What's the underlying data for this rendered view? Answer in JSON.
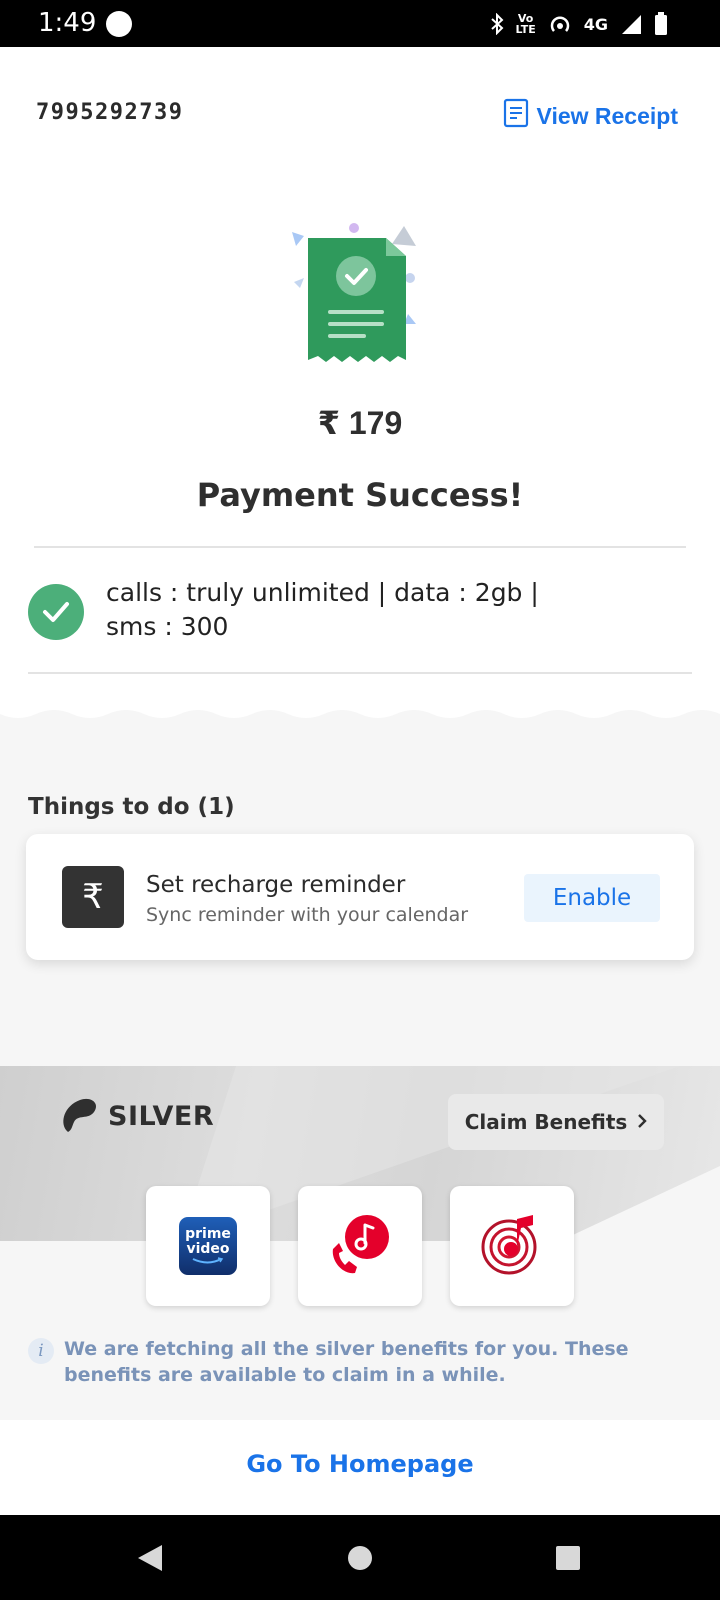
{
  "status_bar": {
    "time": "1:49",
    "volte_top": "Vo",
    "volte_bottom": "LTE",
    "network": "4G"
  },
  "header": {
    "phone_number": "7995292739",
    "view_receipt_label": "View Receipt"
  },
  "payment": {
    "amount": "₹ 179",
    "status_title": "Payment Success!",
    "plan_details": "calls : truly unlimited | data : 2gb | sms : 300"
  },
  "things_to_do": {
    "title": "Things to do (1)",
    "items": [
      {
        "icon_glyph": "₹",
        "title": "Set recharge reminder",
        "subtitle": "Sync reminder with your calendar",
        "action_label": "Enable"
      }
    ]
  },
  "silver": {
    "tier_label": "SILVER",
    "claim_label": "Claim Benefits",
    "benefits": [
      {
        "name": "prime-video",
        "line1": "prime",
        "line2": "video"
      },
      {
        "name": "hellotunes",
        "icon": "music-phone-icon"
      },
      {
        "name": "wynk-music",
        "icon": "wynk-music-icon"
      }
    ],
    "info_text": "We are fetching all the silver benefits for you. These benefits are available to claim in a while."
  },
  "footer": {
    "home_link": "Go To Homepage"
  },
  "colors": {
    "accent_blue": "#1a73e8",
    "success_green": "#4caf7a",
    "brand_red": "#e4002b",
    "info_text": "#7a93b8"
  }
}
